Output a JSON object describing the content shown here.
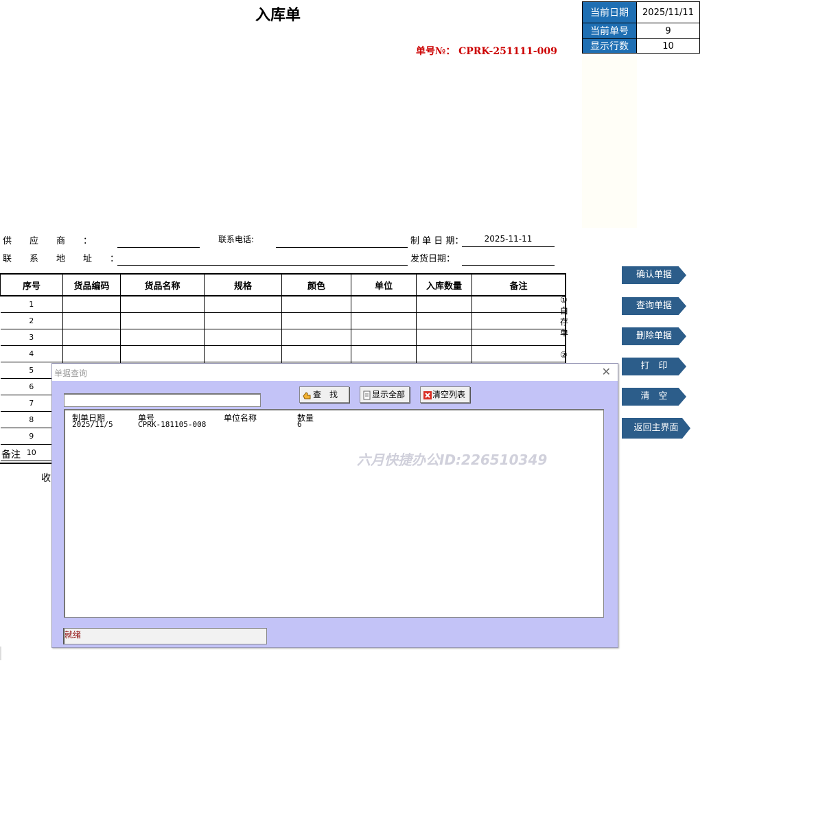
{
  "header": {
    "title": "入库单",
    "doc_no_label": "单号№：",
    "doc_no_value": "CPRK-251111-009"
  },
  "info": {
    "date_label": "当前日期",
    "date_value": "2025/11/11",
    "num_label": "当前单号",
    "num_value": "9",
    "rows_label": "显示行数",
    "rows_value": "10"
  },
  "form": {
    "supplier_label": "供　　应　　商　　：",
    "phone_label": "联系电话:",
    "date_label": "制 单 日 期：",
    "date_value": "2025-11-11",
    "address_label": "联　　系　　地　　址　　：",
    "ship_label": "发货日期："
  },
  "table": {
    "headers": [
      "序号",
      "货品编码",
      "货品名称",
      "规格",
      "颜色",
      "单位",
      "入库数量",
      "备注"
    ],
    "row_numbers": [
      "1",
      "2",
      "3",
      "4",
      "5",
      "6",
      "7",
      "8",
      "9",
      "10"
    ]
  },
  "footer": {
    "note_label": "备注",
    "receiver_label": "收"
  },
  "side_note": {
    "line1": "①白存单",
    "line2": "②"
  },
  "side_buttons": {
    "confirm": "确认单据",
    "query": "查询单据",
    "delete": "删除单据",
    "print": "打　印",
    "clear": "清　空",
    "back": "返回主界面"
  },
  "dialog": {
    "title": "单据查询",
    "search_value": "",
    "find_btn": "查　找",
    "show_all_btn": "显示全部",
    "clear_list_btn": "清空列表",
    "columns": [
      "制单日期",
      "单号",
      "单位名称",
      "数量"
    ],
    "rows": [
      {
        "date": "2025/11/5",
        "no": "CPRK-181105-008",
        "unit": "",
        "qty": "6"
      }
    ],
    "watermark": "六月快捷办公ID:226510349",
    "status": "就绪"
  }
}
